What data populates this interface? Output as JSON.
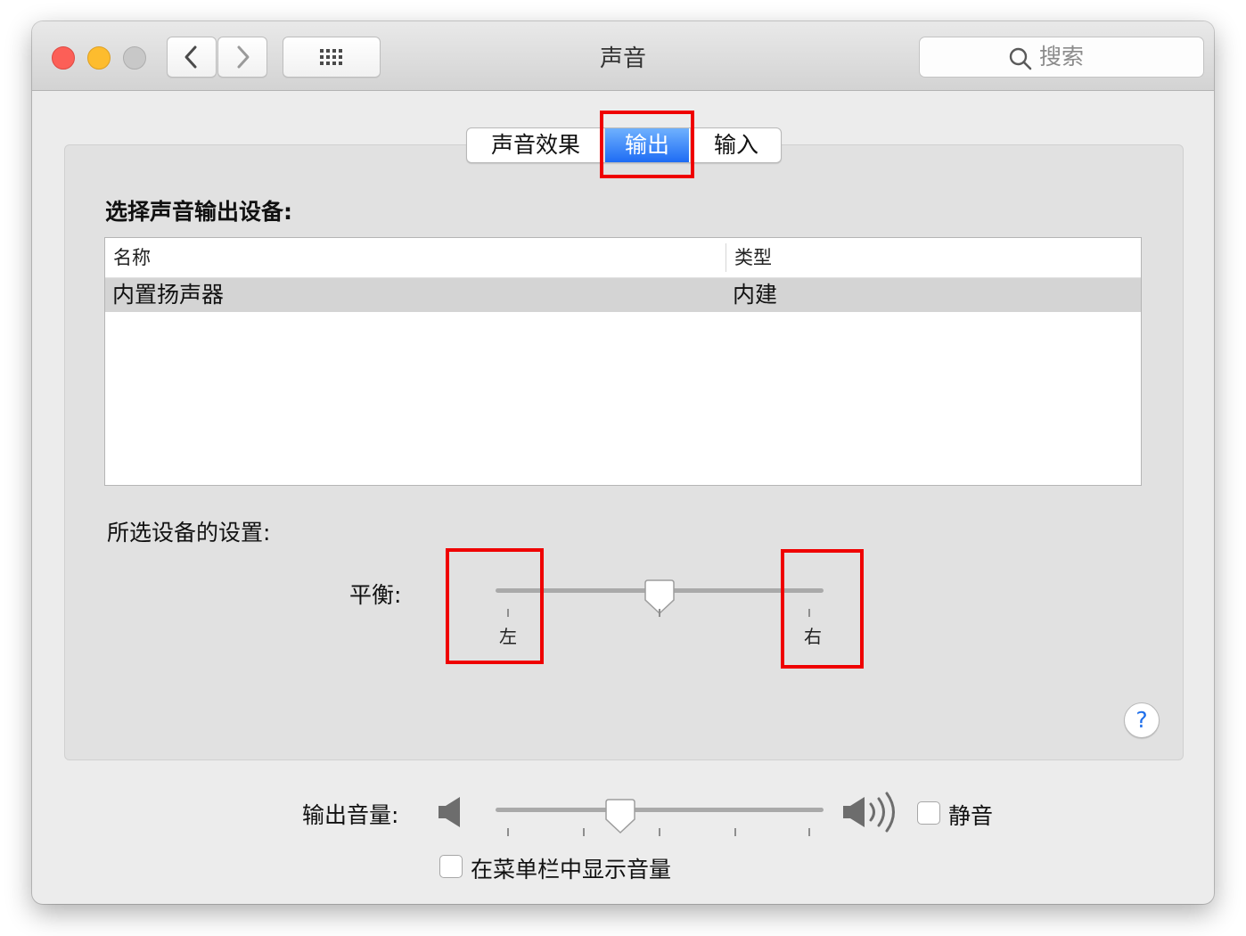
{
  "window": {
    "title": "声音",
    "search_placeholder": "搜索"
  },
  "tabs": [
    {
      "label": "声音效果",
      "selected": false
    },
    {
      "label": "输出",
      "selected": true
    },
    {
      "label": "输入",
      "selected": false
    }
  ],
  "output": {
    "choose_device_label": "选择声音输出设备:",
    "table": {
      "columns": [
        "名称",
        "类型"
      ],
      "rows": [
        {
          "name": "内置扬声器",
          "type": "内建",
          "selected": true
        }
      ]
    },
    "selected_settings_label": "所选设备的设置:",
    "balance": {
      "label": "平衡:",
      "left_label": "左",
      "right_label": "右",
      "value_fraction": 0.5
    }
  },
  "volume": {
    "label": "输出音量:",
    "value_fraction": 0.38,
    "mute_label": "静音",
    "mute_checked": false,
    "show_in_menubar_label": "在菜单栏中显示音量",
    "show_in_menubar_checked": false
  },
  "help": {
    "symbol": "?"
  },
  "colors": {
    "accent": "#1e6cf4",
    "highlight_box": "#ef0000",
    "close": "#fc5f57",
    "minimize": "#fdbc2e",
    "zoom_disabled": "#c8c8c8"
  }
}
